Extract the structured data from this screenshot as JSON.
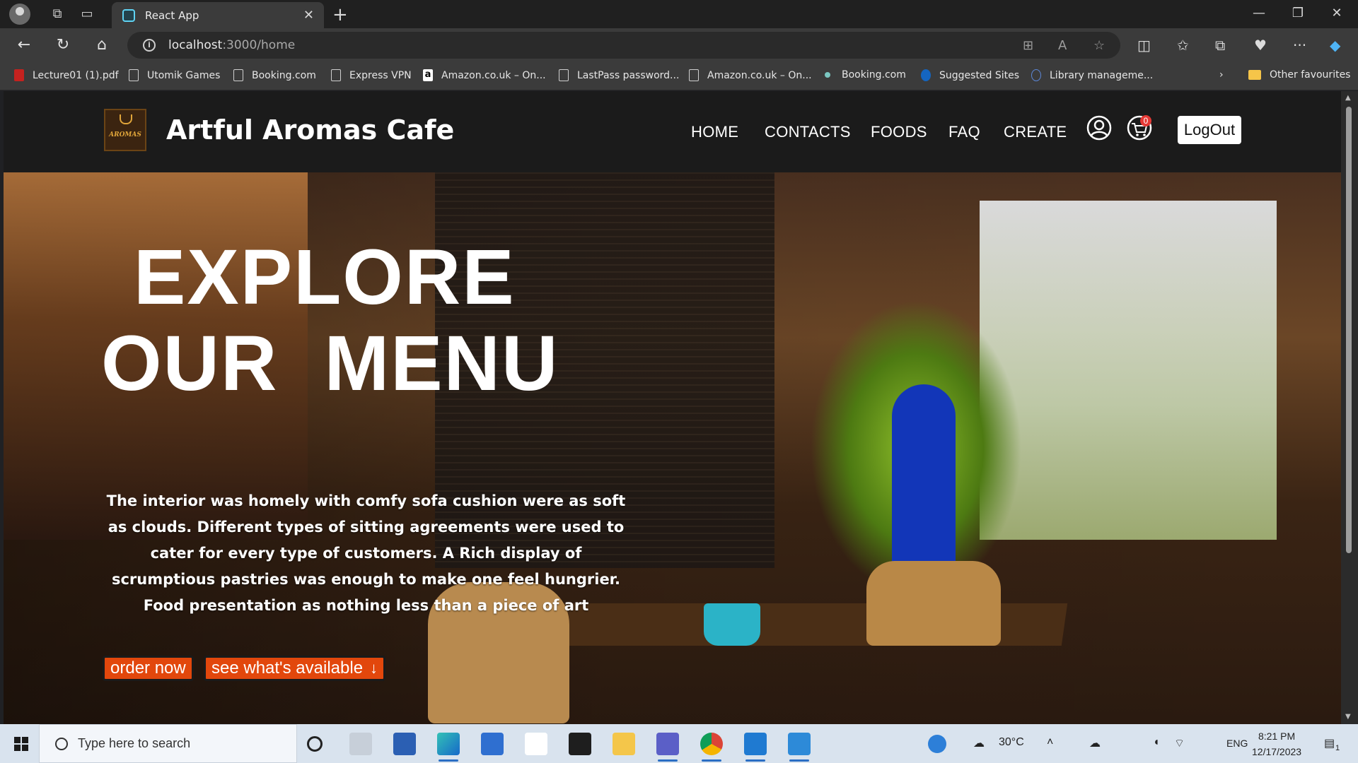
{
  "browser": {
    "tab_title": "React App",
    "url_host": "localhost",
    "url_path": ":3000/home",
    "bookmarks": [
      "Lecture01 (1).pdf",
      "Utomik Games",
      "Booking.com",
      "Express VPN",
      "Amazon.co.uk – On...",
      "LastPass password...",
      "Amazon.co.uk – On...",
      "Booking.com",
      "Suggested Sites",
      "Library manageme..."
    ],
    "other_favourites": "Other favourites"
  },
  "site": {
    "brand": "Artful Aromas Cafe",
    "logo_text": "AROMAS",
    "nav": [
      "HOME",
      "CONTACTS",
      "FOODS",
      "FAQ",
      "CREATE"
    ],
    "cart_count": "0",
    "logout_label": "LogOut"
  },
  "hero": {
    "title_line1": "EXPLORE",
    "title_line2": "OUR  MENU",
    "description": "The interior was homely with comfy sofa cushion were as soft as clouds. Different types of sitting agreements were used to cater for every type of customers. A Rich display of scrumptious pastries was enough to make one feel hungrier. Food presentation as nothing less than a piece of art",
    "order_label": "order now",
    "available_label": "see what's available"
  },
  "taskbar": {
    "search_placeholder": "Type here to search",
    "weather": "30°C",
    "language": "ENG",
    "time": "8:21 PM",
    "date": "12/17/2023",
    "notifications": "1"
  }
}
